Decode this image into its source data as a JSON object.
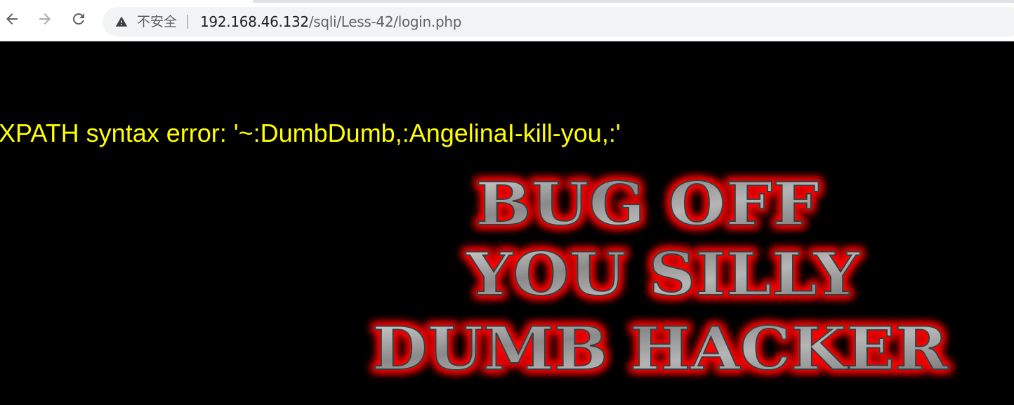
{
  "browser": {
    "security_label": "不安全",
    "url_host": "192.168.46.132",
    "url_path": "/sqli/Less-42/login.php",
    "icons": {
      "back": "back-arrow-icon",
      "forward": "forward-arrow-icon",
      "reload": "reload-icon",
      "security": "warning-triangle-icon"
    }
  },
  "page": {
    "error_message": "XPATH syntax error: '~:DumbDumb,:AngelinaI-kill-you,:'",
    "banner": {
      "line1": "BUG OFF",
      "line2": "YOU SILLY",
      "line3": "DUMB HACKER"
    },
    "colors": {
      "background": "#000000",
      "error_text": "#ffff00",
      "banner_glow": "#ff0000",
      "banner_fill": "#9a9a9a"
    }
  }
}
